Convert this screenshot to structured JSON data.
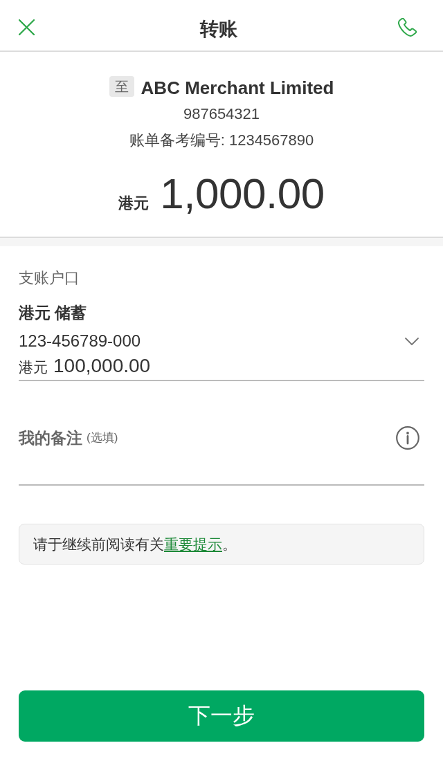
{
  "header": {
    "title": "转账"
  },
  "payee": {
    "badge": "至",
    "name": "ABC Merchant Limited",
    "account": "987654321",
    "reference": "账单备考编号: 1234567890"
  },
  "amount": {
    "currency": "港元",
    "value": "1,000.00"
  },
  "debit_account": {
    "label": "支账户口",
    "name": "港元 储蓄",
    "number": "123-456789-000",
    "balance_currency": "港元",
    "balance": "100,000.00"
  },
  "remark": {
    "label": "我的备注",
    "hint": "(选填)"
  },
  "notice": {
    "text": "请于继续前阅读有关",
    "link": "重要提示",
    "end": "。"
  },
  "next_button": {
    "label": "下一步"
  }
}
